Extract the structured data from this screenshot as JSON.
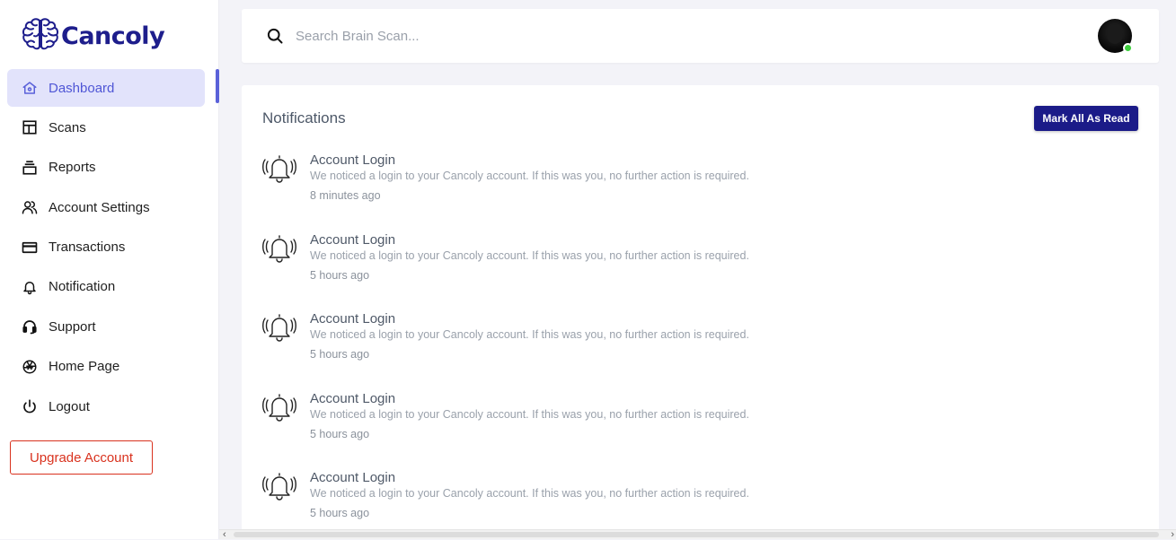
{
  "brand": {
    "name": "Cancoly",
    "logo_icon": "brain-icon",
    "color": "#1e1e8c"
  },
  "sidebar": {
    "items": [
      {
        "label": "Dashboard",
        "icon": "home-icon",
        "active": true
      },
      {
        "label": "Scans",
        "icon": "layout-icon"
      },
      {
        "label": "Reports",
        "icon": "archive-icon"
      },
      {
        "label": "Account Settings",
        "icon": "users-icon"
      },
      {
        "label": "Transactions",
        "icon": "credit-card-icon"
      },
      {
        "label": "Notification",
        "icon": "bell-icon"
      },
      {
        "label": "Support",
        "icon": "headset-icon"
      },
      {
        "label": "Home Page",
        "icon": "aperture-icon"
      },
      {
        "label": "Logout",
        "icon": "power-icon"
      }
    ],
    "upgrade_label": "Upgrade Account",
    "accent": "#5a61d9",
    "upgrade_color": "#d9321e"
  },
  "search": {
    "placeholder": "Search Brain Scan...",
    "value": ""
  },
  "user": {
    "online": true,
    "status_color": "#3ecf3e"
  },
  "notifications": {
    "title": "Notifications",
    "mark_all_label": "Mark All As Read",
    "button_color": "#1b1b88",
    "items": [
      {
        "title": "Account Login",
        "message": "We noticed a login to your Cancoly account. If this was you, no further action is required.",
        "time": "8 minutes ago",
        "icon": "bell-ringing-icon"
      },
      {
        "title": "Account Login",
        "message": "We noticed a login to your Cancoly account. If this was you, no further action is required.",
        "time": "5 hours ago",
        "icon": "bell-ringing-icon"
      },
      {
        "title": "Account Login",
        "message": "We noticed a login to your Cancoly account. If this was you, no further action is required.",
        "time": "5 hours ago",
        "icon": "bell-ringing-icon"
      },
      {
        "title": "Account Login",
        "message": "We noticed a login to your Cancoly account. If this was you, no further action is required.",
        "time": "5 hours ago",
        "icon": "bell-ringing-icon"
      },
      {
        "title": "Account Login",
        "message": "We noticed a login to your Cancoly account. If this was you, no further action is required.",
        "time": "5 hours ago",
        "icon": "bell-ringing-icon"
      }
    ]
  }
}
